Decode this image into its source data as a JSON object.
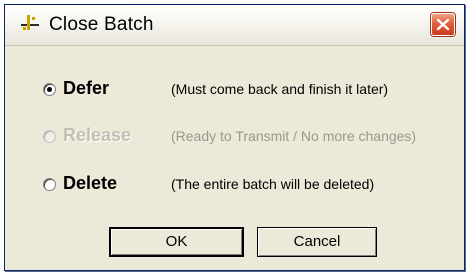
{
  "window": {
    "title": "Close Batch",
    "icon": "batch-icon",
    "close_icon": "close-icon"
  },
  "options": [
    {
      "label": "Defer",
      "description": "(Must come back and finish it later)",
      "selected": true,
      "enabled": true
    },
    {
      "label": "Release",
      "description": "(Ready to Transmit / No more changes)",
      "selected": false,
      "enabled": false
    },
    {
      "label": "Delete",
      "description": "(The entire batch will be deleted)",
      "selected": false,
      "enabled": true
    }
  ],
  "buttons": {
    "ok_label": "OK",
    "cancel_label": "Cancel"
  },
  "colors": {
    "dialog_background": "#ece9d8",
    "close_button": "#e0603f",
    "disabled_text": "#c2c0b4"
  }
}
